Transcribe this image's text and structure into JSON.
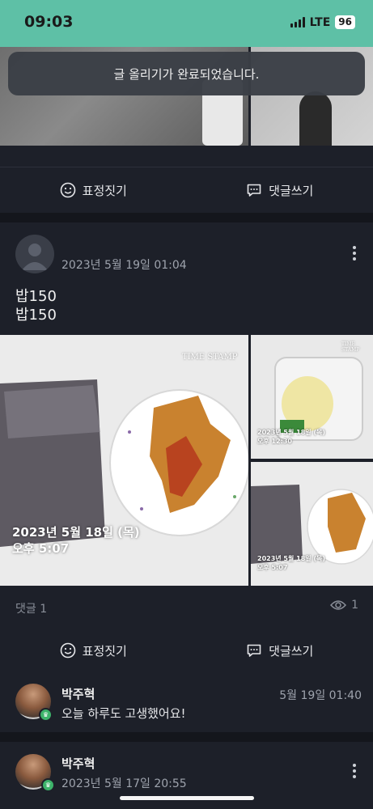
{
  "status_bar": {
    "time": "09:03",
    "network": "LTE",
    "battery": "96"
  },
  "toast": {
    "message": "글 올리기가 완료되었습니다."
  },
  "actions": {
    "react_label": "표정짓기",
    "comment_label": "댓글쓰기"
  },
  "post": {
    "date": "2023년 5월 19일 01:04",
    "text_lines": [
      "밥150",
      "밥150"
    ],
    "photos": {
      "main_stamp_date": "2023년 5월 18일 (목)",
      "main_stamp_time": "오후 5:07",
      "top_right_stamp_date": "2023년 5월 18일 (목)",
      "top_right_stamp_time": "오후 12:30",
      "bottom_right_stamp_date": "2023년 5월 18일 (목)",
      "bottom_right_stamp_time": "오후 5:07",
      "logo_text": "TIME STAMP"
    },
    "comment_count": "댓글 1",
    "view_count": "1",
    "comment": {
      "author": "박주혁",
      "text": "오늘 하루도 고생했어요!",
      "time": "5월 19일 01:40"
    }
  },
  "next_post": {
    "author": "박주혁",
    "date": "2023년 5월 17일 20:55"
  },
  "colors": {
    "status_bar": "#5ec0a6",
    "background": "#1d2029",
    "badge": "#3db36a"
  }
}
